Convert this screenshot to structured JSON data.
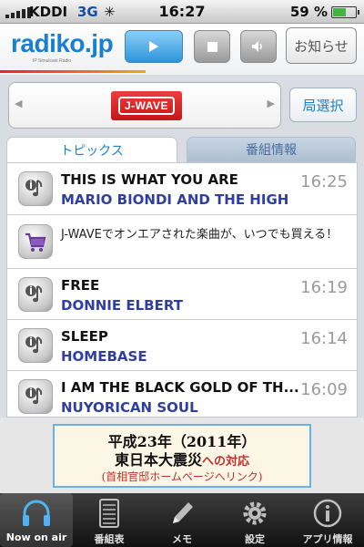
{
  "status_bar": {
    "carrier": "KDDI",
    "network": "3G",
    "time": "16:27",
    "battery_percent": "59 %",
    "battery_level": 0.59
  },
  "header": {
    "logo_text": "radiko.jp",
    "logo_tagline": "IP Simulcast Radio",
    "news_button": "お知らせ"
  },
  "station": {
    "current_name": "J-WAVE",
    "select_button": "局選択"
  },
  "tabs": [
    {
      "label": "トピックス",
      "active": true
    },
    {
      "label": "番組情報",
      "active": false
    }
  ],
  "topics": [
    {
      "type": "song",
      "title": "THIS IS WHAT YOU ARE",
      "artist": "MARIO BIONDI AND THE HIGH",
      "time": "16:25"
    },
    {
      "type": "promo",
      "text": "J-WAVEでオンエアされた楽曲が、いつでも買える！"
    },
    {
      "type": "song",
      "title": "FREE",
      "artist": "DONNIE ELBERT",
      "time": "16:19"
    },
    {
      "type": "song",
      "title": "SLEEP",
      "artist": "HOMEBASE",
      "time": "16:14"
    },
    {
      "type": "song",
      "title": "I AM THE BLACK GOLD OF TH...",
      "artist": "NUYORICAN SOUL",
      "time": "16:09"
    }
  ],
  "banner": {
    "line1": "平成23年（2011年）",
    "line2_main": "東日本大震災",
    "line2_sub": "への対応",
    "line3": "(首相官邸ホームページへリンク)"
  },
  "tab_bar": [
    {
      "label": "Now on air",
      "icon": "headphones-icon",
      "active": true
    },
    {
      "label": "番組表",
      "icon": "schedule-icon",
      "active": false
    },
    {
      "label": "メモ",
      "icon": "pencil-icon",
      "active": false
    },
    {
      "label": "設定",
      "icon": "gear-icon",
      "active": false
    },
    {
      "label": "アプリ情報",
      "icon": "info-icon",
      "active": false
    }
  ],
  "colors": {
    "brand_blue": "#1a7fd0",
    "artist_blue": "#2f3fa0",
    "station_red": "#d9252a"
  }
}
